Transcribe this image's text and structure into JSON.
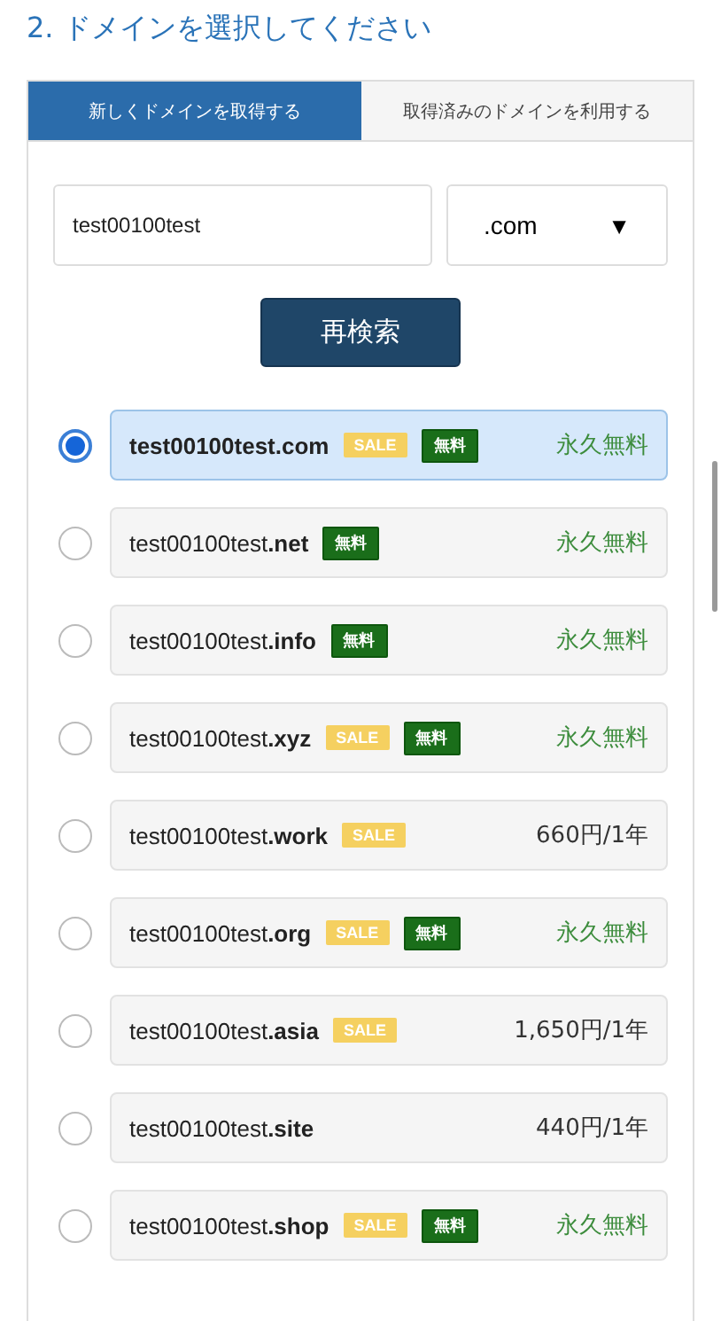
{
  "title": "2. ドメインを選択してください",
  "tabs": [
    {
      "label": "新しくドメインを取得する",
      "selected": true
    },
    {
      "label": "取得済みのドメインを利用する",
      "selected": false
    }
  ],
  "search": {
    "value": "test00100test",
    "tld": ".com",
    "dropdown_icon": "▼",
    "button": "再検索"
  },
  "domains": [
    {
      "kind": "free",
      "name": "test00100test.com",
      "selected": true,
      "badges": [
        {
          "kind": "sale",
          "label": "SALE"
        },
        {
          "kind": "free",
          "label": "無料"
        }
      ],
      "price": "永久無料"
    },
    {
      "kind": "free",
      "name": "test00100test**.net**",
      "selected": false,
      "badges": [
        {
          "kind": "free",
          "label": "無料"
        }
      ],
      "price": "永久無料"
    },
    {
      "kind": "free",
      "name": "test00100test**.info**",
      "selected": false,
      "badges": [
        {
          "kind": "free",
          "label": "無料"
        }
      ],
      "price": "永久無料"
    },
    {
      "kind": "free",
      "name": "test00100test**.xyz**",
      "selected": false,
      "badges": [
        {
          "kind": "sale",
          "label": "SALE"
        },
        {
          "kind": "free",
          "label": "無料"
        }
      ],
      "price": "永久無料"
    },
    {
      "kind": "paid",
      "name": "test00100test**.work**",
      "selected": false,
      "badges": [
        {
          "kind": "sale",
          "label": "SALE"
        }
      ],
      "price": "660円/1年"
    },
    {
      "kind": "free",
      "name": "test00100test**.org**",
      "selected": false,
      "badges": [
        {
          "kind": "sale",
          "label": "SALE"
        },
        {
          "kind": "free",
          "label": "無料"
        }
      ],
      "price": "永久無料"
    },
    {
      "kind": "paid",
      "name": "test00100test**.asia**",
      "selected": false,
      "badges": [
        {
          "kind": "sale",
          "label": "SALE"
        }
      ],
      "price": "1,650円/1年"
    },
    {
      "kind": "paid",
      "name": "test00100test**.site**",
      "selected": false,
      "price": "440円/1年"
    },
    {
      "kind": "free",
      "name": "test00100test**.shop**",
      "selected": false,
      "badges": [
        {
          "kind": "sale",
          "label": "SALE"
        },
        {
          "kind": "free",
          "label": "無料"
        }
      ],
      "price": "永久無料"
    }
  ]
}
